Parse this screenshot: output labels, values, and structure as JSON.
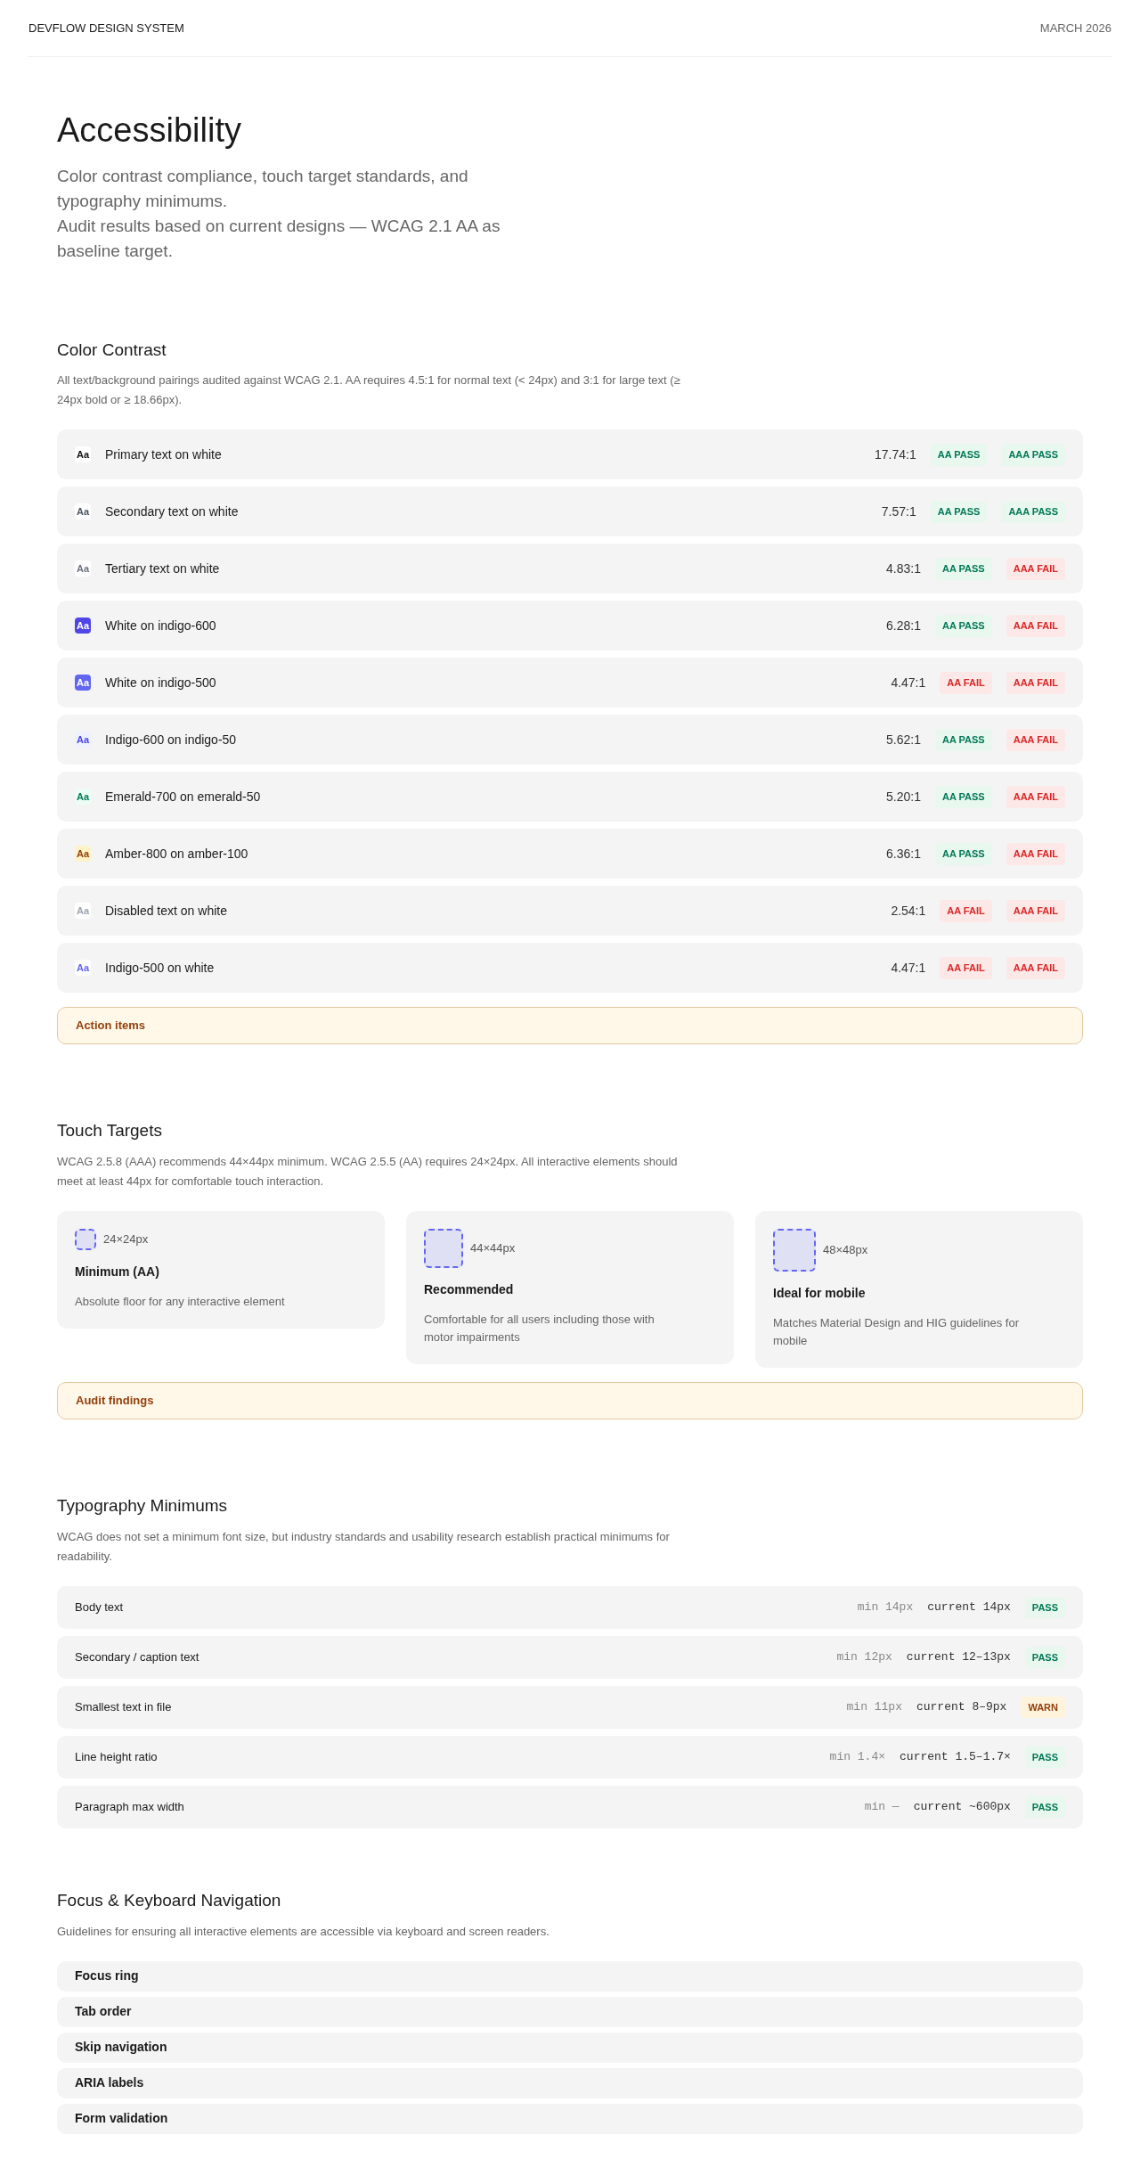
{
  "header": {
    "brand": "DEVFLOW DESIGN SYSTEM",
    "date": "MARCH 2026"
  },
  "page": {
    "title": "Accessibility",
    "subtitle_lines": [
      "Color contrast compliance, touch target standards, and typography minimums.",
      "Audit results based on current designs — WCAG 2.1 AA as baseline target."
    ]
  },
  "color_contrast": {
    "title": "Color Contrast",
    "description": "All text/background pairings audited against WCAG 2.1. AA requires 4.5:1 for normal text (< 24px) and 3:1 for large text (≥ 24px bold or ≥ 18.66px).",
    "rows": [
      {
        "swatch": "Aa",
        "kind": "primary",
        "label": "Primary text on white",
        "ratio": "17.74:1",
        "aa": {
          "label": "AA PASS",
          "pass": true
        },
        "aaa": {
          "label": "AAA PASS",
          "pass": true
        }
      },
      {
        "swatch": "Aa",
        "kind": "secondary",
        "label": "Secondary text on white",
        "ratio": "7.57:1",
        "aa": {
          "label": "AA PASS",
          "pass": true
        },
        "aaa": {
          "label": "AAA PASS",
          "pass": true
        }
      },
      {
        "swatch": "Aa",
        "kind": "tertiary",
        "label": "Tertiary text on white",
        "ratio": "4.83:1",
        "aa": {
          "label": "AA PASS",
          "pass": true
        },
        "aaa": {
          "label": "AAA FAIL",
          "pass": false
        }
      },
      {
        "swatch": "Aa",
        "kind": "indigo-600-fill",
        "label": "White on indigo-600",
        "ratio": "6.28:1",
        "aa": {
          "label": "AA PASS",
          "pass": true
        },
        "aaa": {
          "label": "AAA FAIL",
          "pass": false
        }
      },
      {
        "swatch": "Aa",
        "kind": "indigo-500-fill",
        "label": "White on indigo-500",
        "ratio": "4.47:1",
        "aa": {
          "label": "AA FAIL",
          "pass": false
        },
        "aaa": {
          "label": "AAA FAIL",
          "pass": false
        }
      },
      {
        "swatch": "Aa",
        "kind": "indigo-tint",
        "label": "Indigo-600 on indigo-50",
        "ratio": "5.62:1",
        "aa": {
          "label": "AA PASS",
          "pass": true
        },
        "aaa": {
          "label": "AAA FAIL",
          "pass": false
        }
      },
      {
        "swatch": "Aa",
        "kind": "emerald-tint",
        "label": "Emerald-700 on emerald-50",
        "ratio": "5.20:1",
        "aa": {
          "label": "AA PASS",
          "pass": true
        },
        "aaa": {
          "label": "AAA FAIL",
          "pass": false
        }
      },
      {
        "swatch": "Aa",
        "kind": "amber-tint",
        "label": "Amber-800 on amber-100",
        "ratio": "6.36:1",
        "aa": {
          "label": "AA PASS",
          "pass": true
        },
        "aaa": {
          "label": "AAA FAIL",
          "pass": false
        }
      },
      {
        "swatch": "Aa",
        "kind": "disabled",
        "label": "Disabled text on white",
        "ratio": "2.54:1",
        "aa": {
          "label": "AA FAIL",
          "pass": false
        },
        "aaa": {
          "label": "AAA FAIL",
          "pass": false
        }
      },
      {
        "swatch": "Aa",
        "kind": "indigo-text",
        "label": "Indigo-500 on white",
        "ratio": "4.47:1",
        "aa": {
          "label": "AA FAIL",
          "pass": false
        },
        "aaa": {
          "label": "AAA FAIL",
          "pass": false
        }
      }
    ],
    "callout": {
      "title": "Action items"
    }
  },
  "touch_targets": {
    "title": "Touch Targets",
    "description": "WCAG 2.5.8 (AAA) recommends 44×44px minimum. WCAG 2.5.5 (AA) requires 24×24px. All interactive elements should meet at least 44px for comfortable touch interaction.",
    "cards": [
      {
        "kind": "small",
        "size": "24×24px",
        "title": "Minimum (AA)",
        "description": "Absolute floor for any interactive element"
      },
      {
        "kind": "medium",
        "size": "44×44px",
        "title": "Recommended",
        "description": "Comfortable for all users including those with motor impairments"
      },
      {
        "kind": "large",
        "size": "48×48px",
        "title": "Ideal for mobile",
        "description": "Matches Material Design and HIG guidelines for mobile"
      }
    ],
    "callout": {
      "title": "Audit findings"
    }
  },
  "typography": {
    "title": "Typography Minimums",
    "description": "WCAG does not set a minimum font size, but industry standards and usability research establish practical minimums for readability.",
    "rows": [
      {
        "label": "Body text",
        "minimum": "min 14px",
        "current": "current 14px",
        "status": {
          "kind": "pass",
          "label": "PASS"
        }
      },
      {
        "label": "Secondary / caption text",
        "minimum": "min 12px",
        "current": "current 12–13px",
        "status": {
          "kind": "pass",
          "label": "PASS"
        }
      },
      {
        "label": "Smallest text in file",
        "minimum": "min 11px",
        "current": "current 8–9px",
        "status": {
          "kind": "warn",
          "label": "WARN"
        }
      },
      {
        "label": "Line height ratio",
        "minimum": "min 1.4×",
        "current": "current 1.5–1.7×",
        "status": {
          "kind": "pass",
          "label": "PASS"
        }
      },
      {
        "label": "Paragraph max width",
        "minimum": "min —",
        "current": "current ~600px",
        "status": {
          "kind": "pass",
          "label": "PASS"
        }
      }
    ]
  },
  "focus": {
    "title": "Focus & Keyboard Navigation",
    "description": "Guidelines for ensuring all interactive elements are accessible via keyboard and screen readers.",
    "items": [
      "Focus ring",
      "Tab order",
      "Skip navigation",
      "ARIA labels",
      "Form validation"
    ]
  }
}
